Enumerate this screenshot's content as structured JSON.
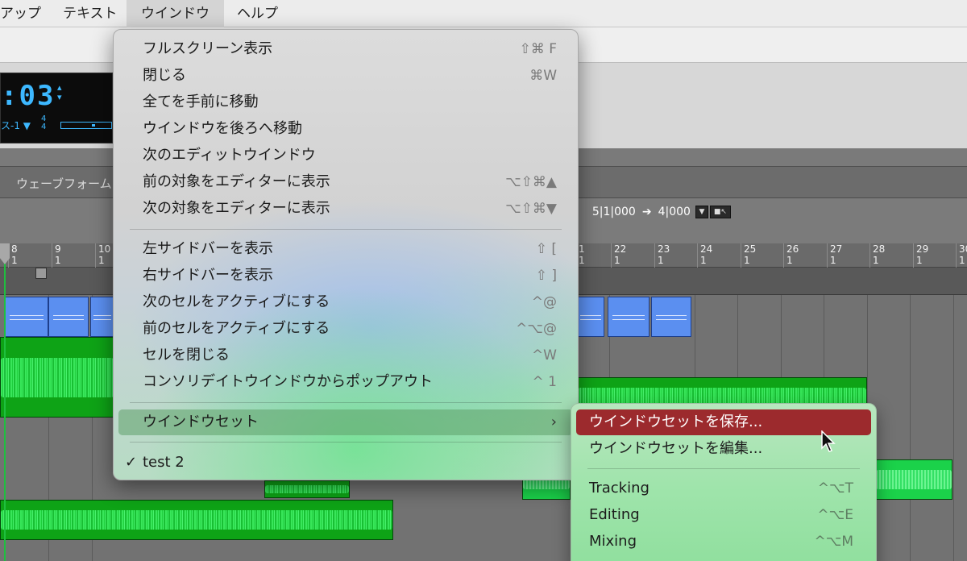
{
  "menubar": {
    "items": [
      {
        "label": "アップ"
      },
      {
        "label": "テキスト"
      },
      {
        "label": "ウインドウ"
      },
      {
        "label": "ヘルプ"
      }
    ]
  },
  "counter": {
    "digits": ":03",
    "meter_label": "ス-1 ▼",
    "sig_top": "4",
    "sig_bottom": "4"
  },
  "waveform_row": {
    "label": "ウェーブフォーム"
  },
  "nudge": {
    "start": "5|1|000",
    "length": "4|000",
    "arrow": "➔"
  },
  "ruler": {
    "left_ticks": [
      {
        "bar": "8",
        "beat": "1"
      },
      {
        "bar": "9",
        "beat": "1"
      },
      {
        "bar": "10",
        "beat": "1"
      }
    ],
    "right_ticks": [
      {
        "bar": "1",
        "beat": "1"
      },
      {
        "bar": "22",
        "beat": "1"
      },
      {
        "bar": "23",
        "beat": "1"
      },
      {
        "bar": "24",
        "beat": "1"
      },
      {
        "bar": "25",
        "beat": "1"
      },
      {
        "bar": "26",
        "beat": "1"
      },
      {
        "bar": "27",
        "beat": "1"
      },
      {
        "bar": "28",
        "beat": "1"
      },
      {
        "bar": "29",
        "beat": "1"
      },
      {
        "bar": "30",
        "beat": "1"
      }
    ]
  },
  "window_menu": {
    "group1": [
      {
        "label": "フルスクリーン表示",
        "shortcut": "⇧⌘ F"
      },
      {
        "label": "閉じる",
        "shortcut": "⌘W"
      },
      {
        "label": "全てを手前に移動",
        "shortcut": ""
      },
      {
        "label": "ウインドウを後ろへ移動",
        "shortcut": ""
      },
      {
        "label": "次のエディットウインドウ",
        "shortcut": ""
      },
      {
        "label": "前の対象をエディターに表示",
        "shortcut": "⌥⇧⌘▲"
      },
      {
        "label": "次の対象をエディターに表示",
        "shortcut": "⌥⇧⌘▼"
      }
    ],
    "group2": [
      {
        "label": "左サイドバーを表示",
        "shortcut": "⇧ ["
      },
      {
        "label": "右サイドバーを表示",
        "shortcut": "⇧ ]"
      },
      {
        "label": "次のセルをアクティブにする",
        "shortcut": "^@"
      },
      {
        "label": "前のセルをアクティブにする",
        "shortcut": "^⌥@"
      },
      {
        "label": "セルを閉じる",
        "shortcut": "^W"
      },
      {
        "label": "コンソリデイトウインドウからポップアウト",
        "shortcut": "^ 1"
      }
    ],
    "window_set": {
      "label": "ウインドウセット",
      "chevron": "›"
    },
    "current": {
      "check": "✓",
      "label": "test 2"
    }
  },
  "window_set_submenu": {
    "save": {
      "label": "ウインドウセットを保存..."
    },
    "edit": {
      "label": "ウインドウセットを編集..."
    },
    "sets": [
      {
        "label": "Tracking",
        "shortcut": "^⌥T"
      },
      {
        "label": "Editing",
        "shortcut": "^⌥E"
      },
      {
        "label": "Mixing",
        "shortcut": "^⌥M"
      }
    ]
  }
}
